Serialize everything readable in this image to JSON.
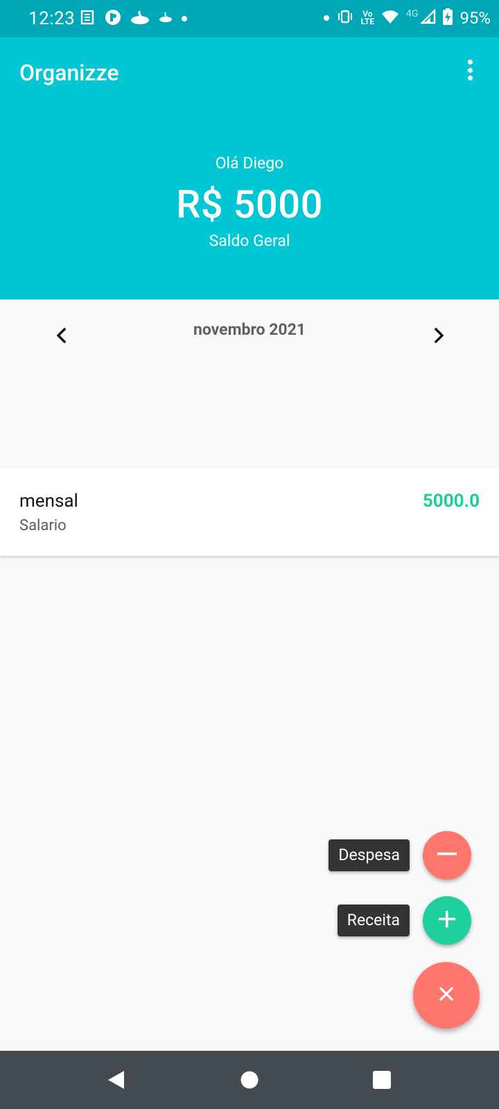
{
  "status_bar": {
    "time": "12:23",
    "network": "4G",
    "volte_top": "Vo",
    "volte_bottom": "LTE",
    "battery": "95%",
    "icons": [
      "news-icon",
      "app-icon",
      "santander-icon",
      "santander-small-icon",
      "dot-icon",
      "dot-icon",
      "vibrate-icon",
      "volte-icon",
      "wifi-icon",
      "signal-icon",
      "battery-charging-icon"
    ]
  },
  "app_bar": {
    "title": "Organizze",
    "menu_icon": "more-vert-icon"
  },
  "summary": {
    "greeting": "Olá Diego",
    "balance": "R$ 5000",
    "balance_label": "Saldo Geral"
  },
  "month": {
    "label": "novembro 2021",
    "prev_icon": "chevron-left-icon",
    "next_icon": "chevron-right-icon"
  },
  "transactions": [
    {
      "title": "mensal",
      "category": "Salario",
      "value": "5000.0",
      "color": "#22cc99"
    }
  ],
  "fab_menu": {
    "expense_label": "Despesa",
    "income_label": "Receita",
    "expense_color": "#ff766d",
    "income_color": "#1ecf9f",
    "main_color": "#ff766d",
    "main_icon": "close-icon"
  },
  "colors": {
    "header": "#00c7d3",
    "status_bar": "#00a7b7",
    "background": "#f9f9f9",
    "navbar": "#434a50"
  },
  "nav_bar": {
    "icons": [
      "back-icon",
      "home-icon",
      "recents-icon"
    ]
  }
}
